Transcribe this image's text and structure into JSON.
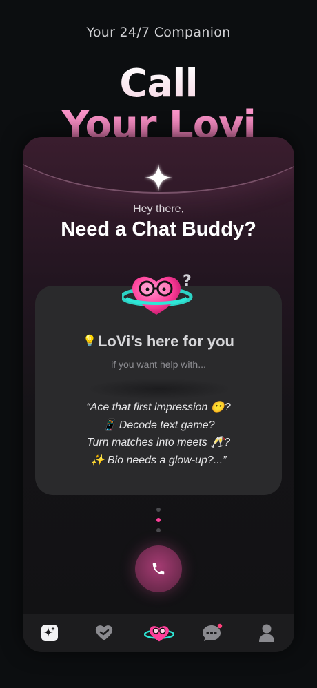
{
  "header": {
    "subtitle": "Your 24/7 Companion",
    "hero_line1": "Call",
    "hero_line2": "Your Lovi"
  },
  "screen": {
    "greeting": "Hey there,",
    "headline": "Need a Chat Buddy?",
    "card": {
      "bulb_emoji": "💡",
      "title": "LoVi’s here for you",
      "subtitle": "if you want help with...",
      "quote_lines": [
        "“Ace that first impression 😶?",
        "📱 Decode text game?",
        "Turn matches into meets 🥂?",
        "✨ Bio needs a glow-up?...”"
      ]
    },
    "carousel": {
      "count": 3,
      "active_index": 1
    },
    "call_button_icon": "phone-icon"
  },
  "tabbar": {
    "items": [
      {
        "icon": "sparkles-app-icon"
      },
      {
        "icon": "heart-icon"
      },
      {
        "icon": "lovi-mascot-icon",
        "active": true
      },
      {
        "icon": "chat-bubble-icon",
        "badge": true
      },
      {
        "icon": "profile-icon"
      }
    ]
  },
  "colors": {
    "accent": "#ff3f9a",
    "mascot_pink": "#ff4fa8",
    "ring_cyan": "#2ee6d6",
    "background": "#0c0e10"
  }
}
